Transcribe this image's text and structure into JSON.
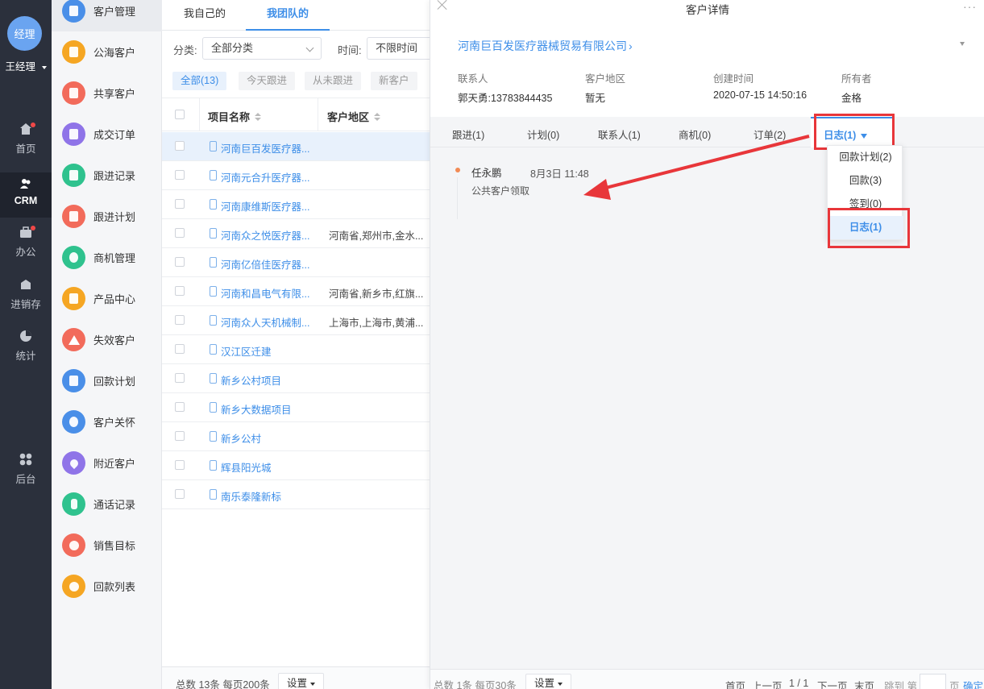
{
  "colors": {
    "accent": "#3d8ee8",
    "highlight_box": "#e8363a",
    "nav_bg": "#2b303c"
  },
  "nav": {
    "avatar_text": "经理",
    "user_name": "王经理",
    "items": [
      {
        "label": "首页",
        "icon": "home-icon",
        "badge": true
      },
      {
        "label": "CRM",
        "icon": "crm-users-icon",
        "active": true
      },
      {
        "label": "办公",
        "icon": "briefcase-icon",
        "badge": true
      },
      {
        "label": "进销存",
        "icon": "warehouse-icon"
      },
      {
        "label": "统计",
        "icon": "pie-chart-icon"
      },
      {
        "label": "后台",
        "icon": "grid-icon"
      }
    ]
  },
  "menu": {
    "items": [
      {
        "label": "客户管理",
        "icon": "customer-icon",
        "color": "#4a8fe8"
      },
      {
        "label": "公海客户",
        "icon": "public-customer-icon",
        "color": "#f5a623"
      },
      {
        "label": "共享客户",
        "icon": "share-customer-icon",
        "color": "#f26b5b"
      },
      {
        "label": "成交订单",
        "icon": "order-icon",
        "color": "#8f74e8"
      },
      {
        "label": "跟进记录",
        "icon": "record-icon",
        "color": "#2fc28e"
      },
      {
        "label": "跟进计划",
        "icon": "plan-icon",
        "color": "#f26b5b"
      },
      {
        "label": "商机管理",
        "icon": "opportunity-icon",
        "color": "#2fc28e"
      },
      {
        "label": "产品中心",
        "icon": "product-icon",
        "color": "#f5a623"
      },
      {
        "label": "失效客户",
        "icon": "warning-icon",
        "color": "#f26b5b"
      },
      {
        "label": "回款计划",
        "icon": "payment-plan-icon",
        "color": "#4a8fe8"
      },
      {
        "label": "客户关怀",
        "icon": "care-icon",
        "color": "#4a8fe8"
      },
      {
        "label": "附近客户",
        "icon": "location-icon",
        "color": "#8f74e8"
      },
      {
        "label": "通话记录",
        "icon": "phone-icon",
        "color": "#2fc28e"
      },
      {
        "label": "销售目标",
        "icon": "target-icon",
        "color": "#f26b5b"
      },
      {
        "label": "回款列表",
        "icon": "payment-list-icon",
        "color": "#f5a623"
      }
    ]
  },
  "list": {
    "tabs": [
      "我自己的",
      "我团队的"
    ],
    "filter": {
      "category_label": "分类:",
      "category_value": "全部分类",
      "time_label": "时间:",
      "time_value": "不限时间"
    },
    "quick_filters": [
      "全部(13)",
      "今天跟进",
      "从未跟进",
      "新客户"
    ],
    "columns": [
      "项目名称",
      "客户地区"
    ],
    "rows": [
      {
        "name": "河南巨百发医疗器...",
        "region": ""
      },
      {
        "name": "河南元合升医疗器...",
        "region": ""
      },
      {
        "name": "河南康维斯医疗器...",
        "region": ""
      },
      {
        "name": "河南众之悦医疗器...",
        "region": "河南省,郑州市,金水..."
      },
      {
        "name": "河南亿倍佳医疗器...",
        "region": ""
      },
      {
        "name": "河南和昌电气有限...",
        "region": "河南省,新乡市,红旗..."
      },
      {
        "name": "河南众人天机械制...",
        "region": "上海市,上海市,黄浦..."
      },
      {
        "name": "汉江区迁建",
        "region": ""
      },
      {
        "name": "新乡公村项目",
        "region": ""
      },
      {
        "name": "新乡大数据项目",
        "region": ""
      },
      {
        "name": "新乡公村",
        "region": ""
      },
      {
        "name": "辉县阳光城",
        "region": ""
      },
      {
        "name": "南乐泰隆新标",
        "region": ""
      }
    ],
    "footer_total": "总数 13条 每页200条",
    "settings_label": "设置"
  },
  "detail": {
    "title": "客户详情",
    "company": "河南巨百发医疗器械贸易有限公司",
    "company_arrow": "›",
    "more": "···",
    "info": [
      {
        "label": "联系人",
        "value": "郭天勇:13783844435"
      },
      {
        "label": "客户地区",
        "value": "暂无"
      },
      {
        "label": "创建时间",
        "value": "2020-07-15 14:50:16"
      },
      {
        "label": "所有者",
        "value": "金格"
      }
    ],
    "tabs": [
      "跟进(1)",
      "计划(0)",
      "联系人(1)",
      "商机(0)",
      "订单(2)",
      "日志(1)"
    ],
    "dropdown": [
      "回款计划(2)",
      "回款(3)",
      "签到(0)",
      "日志(1)"
    ],
    "log": {
      "user": "任永鹏",
      "time": "8月3日 11:48",
      "text": "公共客户领取"
    },
    "footer": {
      "total": "总数 1条 每页30条",
      "settings_label": "设置",
      "first": "首页",
      "prev": "上一页",
      "page": "1 / 1",
      "next": "下一页",
      "last": "末页",
      "jump": "跳到 第",
      "page_unit": "页",
      "confirm": "确定"
    }
  }
}
